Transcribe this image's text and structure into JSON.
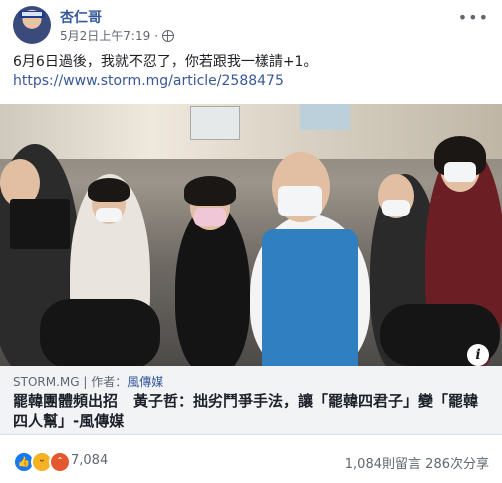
{
  "post": {
    "author": "杏仁哥",
    "timestamp": "5月2日上午7:19",
    "privacy_icon": "globe-icon",
    "more_icon": "more-options-icon",
    "text": "6月6日過後，我就不忍了，你若跟我一樣請+1。",
    "link": "https://www.storm.mg/article/2588475"
  },
  "link_card": {
    "source": "STORM.MG",
    "author_label": "作者：",
    "author": "風傳媒",
    "headline": "罷韓團體頻出招　黃子哲：拙劣鬥爭手法，讓「罷韓四君子」變「罷韓四人幫」-風傳媒",
    "info_icon_label": "i"
  },
  "footer": {
    "reaction_icons": [
      "like-icon",
      "haha-icon",
      "angry-icon"
    ],
    "reaction_count": "7,084",
    "comments": "1,084則留言",
    "shares": "286次分享"
  },
  "colors": {
    "link_blue": "#385898",
    "author_blue": "#365899",
    "card_bg": "#f2f3f5",
    "muted": "#606770"
  }
}
